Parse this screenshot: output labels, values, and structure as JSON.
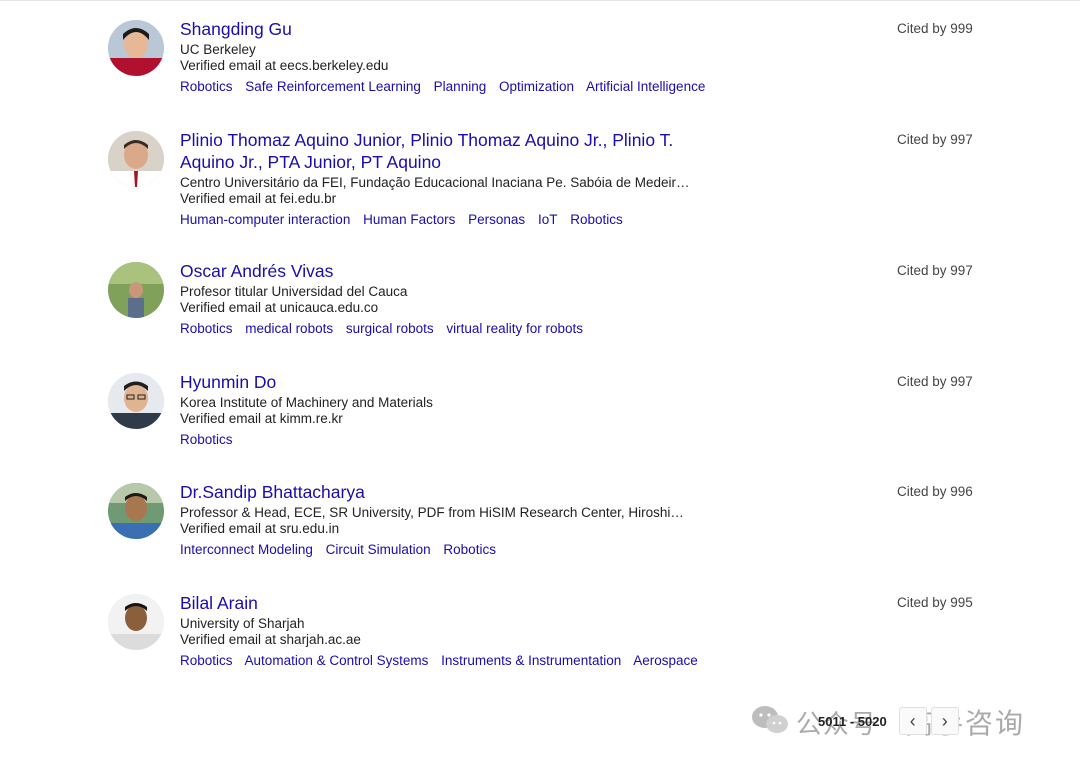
{
  "profiles": [
    {
      "name": "Shangding Gu",
      "affiliation": "UC Berkeley",
      "email": "Verified email at eecs.berkeley.edu",
      "cited": "Cited by 999",
      "tags": [
        "Robotics",
        "Safe Reinforcement Learning",
        "Planning",
        "Optimization",
        "Artificial Intelligence"
      ]
    },
    {
      "name": "Plinio Thomaz Aquino Junior, Plinio Thomaz Aquino Jr., Plinio T. Aquino Jr., PTA Junior, PT Aquino",
      "affiliation": "Centro Universitário da FEI, Fundação Educacional Inaciana Pe. Sabóia de Medeiros …",
      "email": "Verified email at fei.edu.br",
      "cited": "Cited by 997",
      "tags": [
        "Human-computer interaction",
        "Human Factors",
        "Personas",
        "IoT",
        "Robotics"
      ]
    },
    {
      "name": "Oscar Andrés Vivas",
      "affiliation": "Profesor titular Universidad del Cauca",
      "email": "Verified email at unicauca.edu.co",
      "cited": "Cited by 997",
      "tags": [
        "Robotics",
        "medical robots",
        "surgical robots",
        "virtual reality for robots"
      ]
    },
    {
      "name": "Hyunmin Do",
      "affiliation": "Korea Institute of Machinery and Materials",
      "email": "Verified email at kimm.re.kr",
      "cited": "Cited by 997",
      "tags": [
        "Robotics"
      ]
    },
    {
      "name": "Dr.Sandip Bhattacharya",
      "affiliation": "Professor & Head, ECE, SR University, PDF from HiSIM Research Center, Hiroshima …",
      "email": "Verified email at sru.edu.in",
      "cited": "Cited by 996",
      "tags": [
        "Interconnect Modeling",
        "Circuit Simulation",
        "Robotics"
      ]
    },
    {
      "name": "Bilal Arain",
      "affiliation": "University of Sharjah",
      "email": "Verified email at sharjah.ac.ae",
      "cited": "Cited by 995",
      "tags": [
        "Robotics",
        "Automation & Control Systems",
        "Instruments & Instrumentation",
        "Aerospace"
      ]
    }
  ],
  "pagination": {
    "range": "5011 - 5020",
    "prev_icon": "chevron-left-icon",
    "next_icon": "chevron-right-icon"
  },
  "watermark": {
    "left_text": "公众号",
    "right_text": "高手咨询",
    "icon": "wechat-icon"
  },
  "colors": {
    "link": "#1a0dab",
    "text": "#222222",
    "muted": "#444444"
  }
}
